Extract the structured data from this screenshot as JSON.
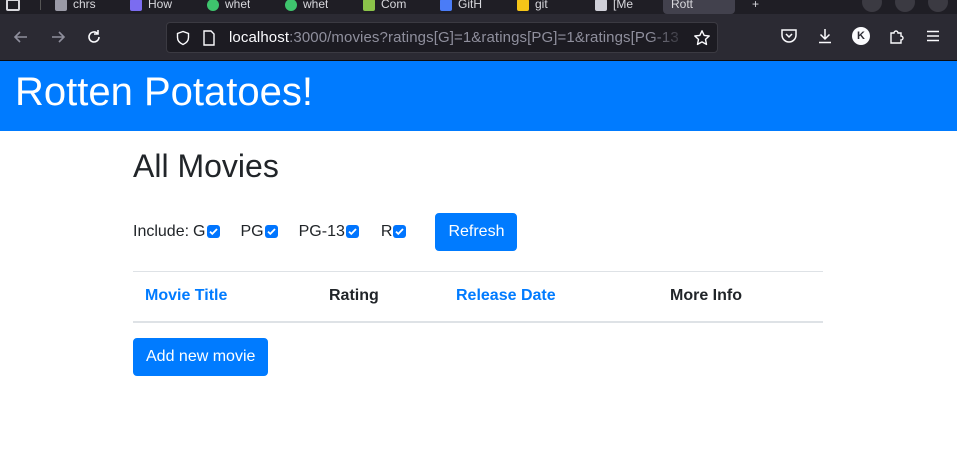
{
  "browser": {
    "tabs": [
      {
        "label": "chrs",
        "color": "#9a9aa6"
      },
      {
        "label": "How",
        "color": "#7b6cf0"
      },
      {
        "label": "whet",
        "color": "#3ec46d"
      },
      {
        "label": "whet",
        "color": "#3ec46d"
      },
      {
        "label": "Com",
        "color": "#8bc34a"
      },
      {
        "label": "GitH",
        "color": "#4a7cf7"
      },
      {
        "label": "git",
        "color": "#f5c518"
      },
      {
        "label": "[Me",
        "color": "#cfcfd8"
      },
      {
        "label": "Rott",
        "color": "#cfcfd8"
      }
    ],
    "url_host": "localhost",
    "url_rest": ":3000/movies?ratings[G]=1&ratings[PG]=1&ratings[PG-13"
  },
  "header": {
    "title": "Rotten Potatoes!"
  },
  "main": {
    "heading": "All Movies",
    "include_label": "Include:",
    "ratings": [
      {
        "label": "G",
        "checked": true
      },
      {
        "label": "PG",
        "checked": true
      },
      {
        "label": "PG-13",
        "checked": true
      },
      {
        "label": "R",
        "checked": true
      }
    ],
    "refresh_label": "Refresh",
    "table": {
      "headers": [
        "Movie Title",
        "Rating",
        "Release Date",
        "More Info"
      ]
    },
    "add_movie_label": "Add new movie"
  },
  "colors": {
    "accent": "#007bff",
    "checkbox": "#0075ff",
    "browser_bg": "#2b2a33"
  }
}
